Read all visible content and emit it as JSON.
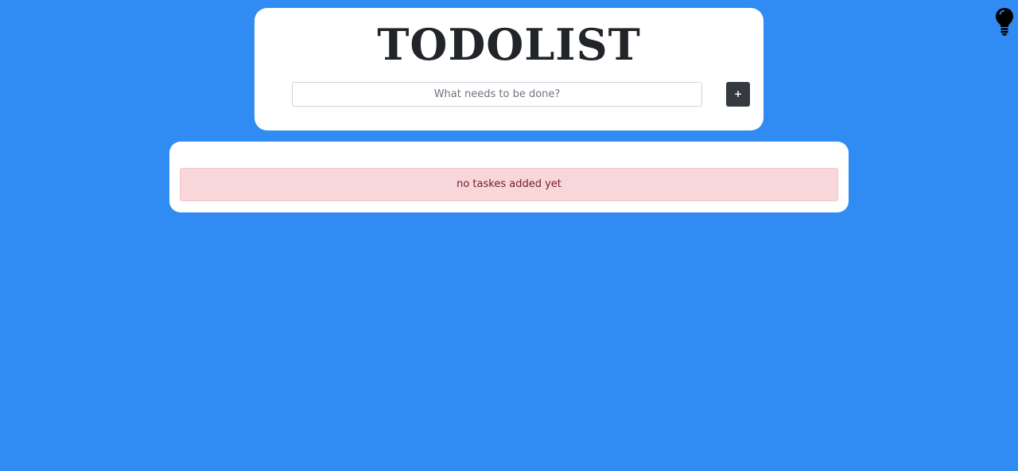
{
  "header": {
    "title": "TODOLIST"
  },
  "input": {
    "placeholder": "What needs to be done?",
    "value": ""
  },
  "add_button": {
    "label": "+"
  },
  "todo_list": {
    "items": [],
    "empty_message": "no taskes added yet"
  },
  "theme_toggle": {
    "icon": "lightbulb-icon"
  },
  "colors": {
    "background": "#308bf2",
    "card": "#ffffff",
    "button": "#343a40",
    "alert_background": "#f8d7da",
    "alert_text": "#721c24"
  }
}
